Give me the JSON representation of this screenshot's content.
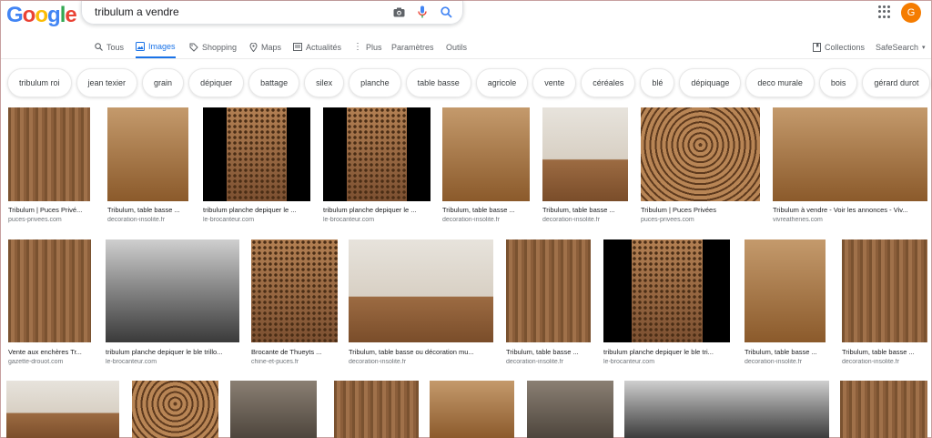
{
  "search": {
    "query": "tribulum a vendre"
  },
  "tabs": [
    {
      "label": "Tous",
      "icon": "search-icon"
    },
    {
      "label": "Images",
      "icon": "image-icon"
    },
    {
      "label": "Shopping",
      "icon": "tag-icon"
    },
    {
      "label": "Maps",
      "icon": "map-icon"
    },
    {
      "label": "Actualités",
      "icon": "news-icon"
    },
    {
      "label": "Plus",
      "icon": "more-icon"
    },
    {
      "label": "Paramètres"
    },
    {
      "label": "Outils"
    }
  ],
  "right_tools": {
    "collections": "Collections",
    "safesearch": "SafeSearch",
    "avatar": "G"
  },
  "chips": [
    "tribulum roi",
    "jean texier",
    "grain",
    "dépiquer",
    "battage",
    "silex",
    "planche",
    "table basse",
    "agricole",
    "vente",
    "céréales",
    "blé",
    "dépiquage",
    "deco murale",
    "bois",
    "gérard durot"
  ],
  "results_row1": [
    {
      "title": "Tribulum | Puces Privé...",
      "source": "puces-privees.com"
    },
    {
      "title": "Tribulum, table basse ...",
      "source": "decoration-insolite.fr"
    },
    {
      "title": "tribulum planche depiquer le ...",
      "source": "le-brocanteur.com"
    },
    {
      "title": "tribulum planche depiquer le ...",
      "source": "le-brocanteur.com"
    },
    {
      "title": "Tribulum, table basse ...",
      "source": "decoration-insolite.fr"
    },
    {
      "title": "Tribulum, table basse ...",
      "source": "decoration-insolite.fr"
    },
    {
      "title": "Tribulum | Puces Privées",
      "source": "puces-privees.com"
    },
    {
      "title": "Tribulum à vendre - Voir les annonces - Viv...",
      "source": "vivreathenes.com"
    }
  ],
  "results_row2": [
    {
      "title": "Vente aux enchères Tr...",
      "source": "gazette-drouot.com"
    },
    {
      "title": "tribulum planche depiquer le ble trillo...",
      "source": "le-brocanteur.com"
    },
    {
      "title": "Brocante de Thueyts ...",
      "source": "chine-et-puces.fr"
    },
    {
      "title": "Tribulum, table basse ou décoration mu...",
      "source": "decoration-insolite.fr"
    },
    {
      "title": "Tribulum, table basse ...",
      "source": "decoration-insolite.fr"
    },
    {
      "title": "tribulum planche depiquer le ble tri...",
      "source": "le-brocanteur.com"
    },
    {
      "title": "Tribulum, table basse ...",
      "source": "decoration-insolite.fr"
    },
    {
      "title": "Tribulum, table basse ...",
      "source": "decoration-insolite.fr"
    }
  ],
  "colors": {
    "accent": "#1a73e8",
    "avatar": "#f57c00"
  }
}
